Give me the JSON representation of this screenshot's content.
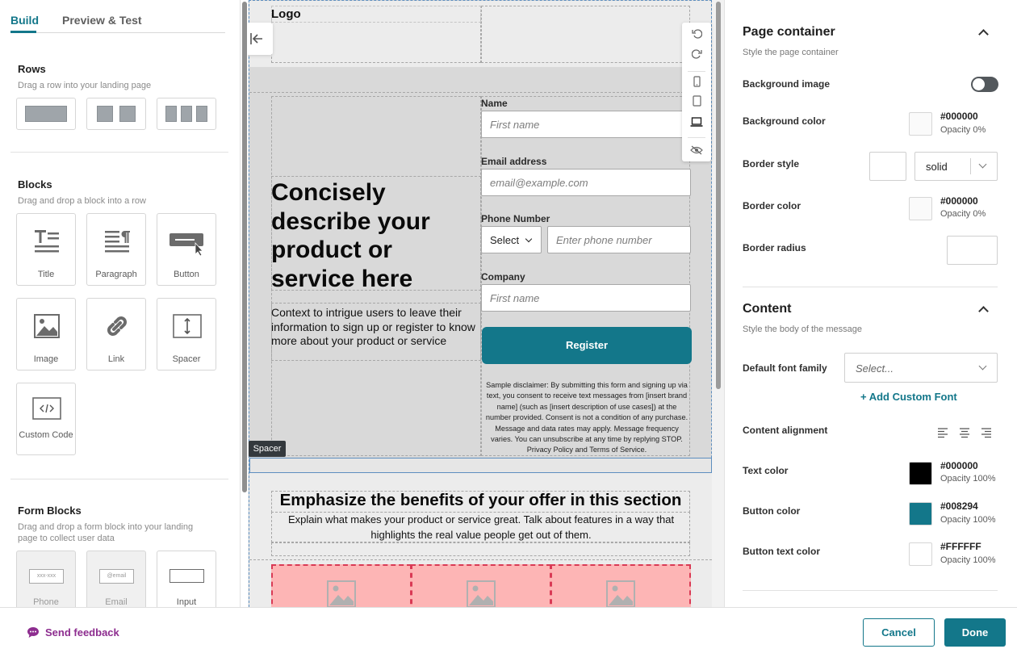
{
  "tabs": {
    "build": "Build",
    "preview": "Preview & Test"
  },
  "rows": {
    "title": "Rows",
    "subtitle": "Drag a row into your landing page"
  },
  "blocks": {
    "title": "Blocks",
    "subtitle": "Drag and drop a block into a row",
    "items": [
      "Title",
      "Paragraph",
      "Button",
      "Image",
      "Link",
      "Spacer",
      "Custom Code"
    ]
  },
  "form_blocks": {
    "title": "Form Blocks",
    "subtitle": "Drag and drop a form block into your landing page to collect user data",
    "items": [
      "Phone",
      "Email",
      "Input"
    ],
    "phone_icon_text": "xxx-xxx",
    "email_icon_text": "@email"
  },
  "canvas": {
    "logo": "Logo",
    "headline": "Concisely describe your product or service here",
    "context": "Context to intrigue users to leave their information to sign up or register to know more about your product or service",
    "form": {
      "name_label": "Name",
      "name_placeholder": "First name",
      "email_label": "Email address",
      "email_placeholder": "email@example.com",
      "phone_label": "Phone Number",
      "phone_select": "Select",
      "phone_placeholder": "Enter phone number",
      "company_label": "Company",
      "company_placeholder": "First name",
      "register": "Register",
      "disclaimer": "Sample disclaimer: By submitting this form and signing up via text, you consent to receive text messages from [insert brand name] (such as [insert description of use cases]) at the number provided. Consent is not a condition of any purchase. Message and data rates may apply. Message frequency varies. You can unsubscribe at any time by replying STOP. Privacy Policy and Terms of Service."
    },
    "spacer_tag": "Spacer",
    "benefits_title": "Emphasize the benefits of your offer in this section",
    "benefits_text": "Explain what makes your product or service great. Talk about features in a way that highlights the real value people get out of them."
  },
  "page_container": {
    "title": "Page container",
    "subtitle": "Style the page container",
    "bg_image_label": "Background image",
    "bg_color_label": "Background color",
    "bg_color_hex": "#000000",
    "bg_color_opacity": "Opacity 0%",
    "border_style_label": "Border style",
    "border_style_value": "solid",
    "border_color_label": "Border color",
    "border_color_hex": "#000000",
    "border_color_opacity": "Opacity 0%",
    "border_radius_label": "Border radius"
  },
  "content": {
    "title": "Content",
    "subtitle": "Style the body of the message",
    "font_family_label": "Default font family",
    "font_family_placeholder": "Select...",
    "add_font": "+ Add Custom Font",
    "alignment_label": "Content alignment",
    "text_color_label": "Text color",
    "text_color_hex": "#000000",
    "text_color_opacity": "Opacity 100%",
    "button_color_label": "Button color",
    "button_color_hex": "#008294",
    "button_color_opacity": "Opacity 100%",
    "button_text_color_label": "Button text color",
    "button_text_color_hex": "#FFFFFF",
    "button_text_color_opacity": "Opacity 100%"
  },
  "footer": {
    "feedback": "Send feedback",
    "cancel": "Cancel",
    "done": "Done"
  },
  "colors": {
    "accent": "#13778a",
    "feedback": "#8d2d8f",
    "text_swatch": "#000000",
    "button_swatch": "#13778a",
    "button_text_swatch": "#ffffff"
  }
}
